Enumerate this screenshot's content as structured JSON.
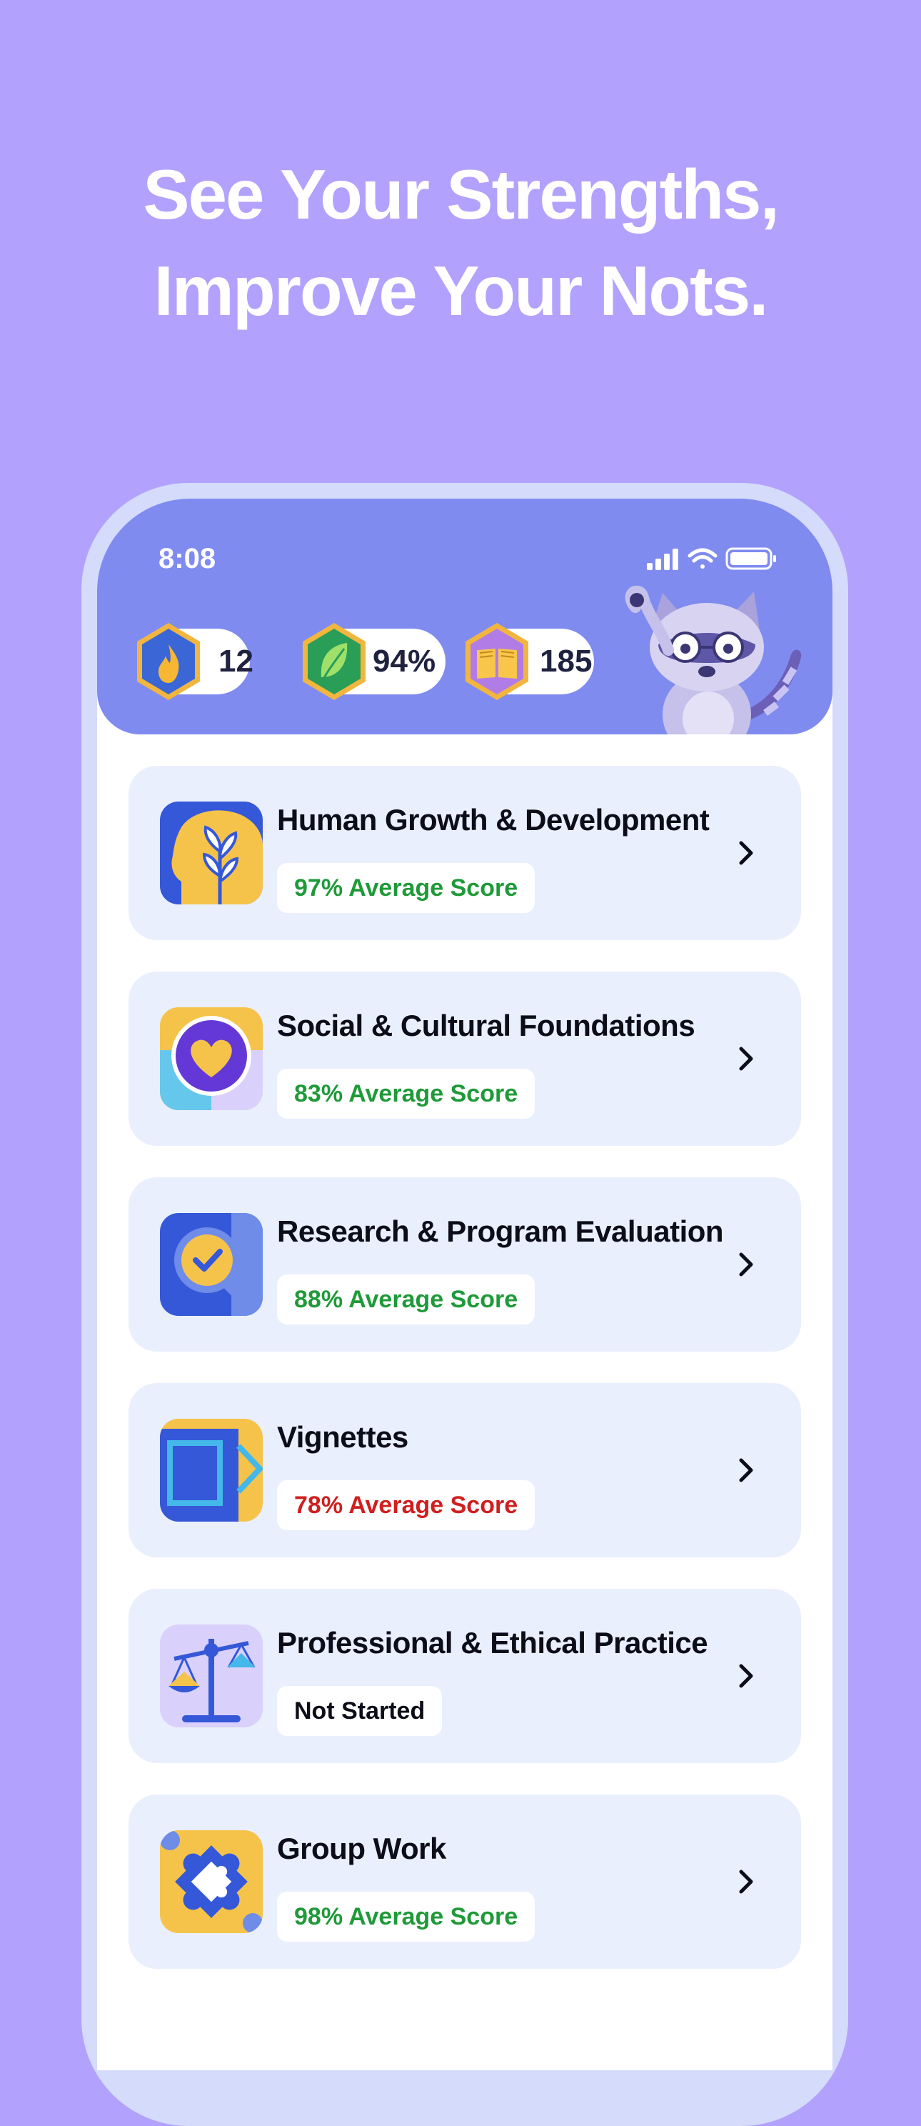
{
  "headline": {
    "line1": "See Your Strengths,",
    "line2": "Improve Your Nots."
  },
  "status_bar": {
    "time": "8:08",
    "icons": [
      "cellular-signal-icon",
      "wifi-icon",
      "battery-icon"
    ]
  },
  "stats": {
    "streak": {
      "icon": "flame-icon",
      "value": "12",
      "color": "#3b67d6"
    },
    "accuracy": {
      "icon": "leaf-icon",
      "value": "94%",
      "color": "#2a9d57"
    },
    "questions": {
      "icon": "book-icon",
      "value": "185",
      "color": "#b27ce6"
    }
  },
  "mascot": {
    "icon": "raccoon-mascot-icon"
  },
  "colors": {
    "background": "#b3a1fe",
    "header": "#7f8bef",
    "card": "#e9effd",
    "score_good": "#1f9a39",
    "score_bad": "#d01f1f",
    "not_started": "#0c0d18"
  },
  "categories": [
    {
      "title": "Human Growth & Development",
      "badge": "97% Average Score",
      "status": "good",
      "icon": "plant-head-icon"
    },
    {
      "title": "Social & Cultural Foundations",
      "badge": "83% Average Score",
      "status": "good",
      "icon": "heart-icon"
    },
    {
      "title": "Research & Program Evaluation",
      "badge": "88% Average Score",
      "status": "good",
      "icon": "magnifier-check-icon"
    },
    {
      "title": "Vignettes",
      "badge": "78% Average Score",
      "status": "bad",
      "icon": "cards-icon"
    },
    {
      "title": "Professional & Ethical Practice",
      "badge": "Not Started",
      "status": "none",
      "icon": "scales-icon"
    },
    {
      "title": "Group Work",
      "badge": "98% Average Score",
      "status": "good",
      "icon": "puzzle-icon"
    }
  ]
}
